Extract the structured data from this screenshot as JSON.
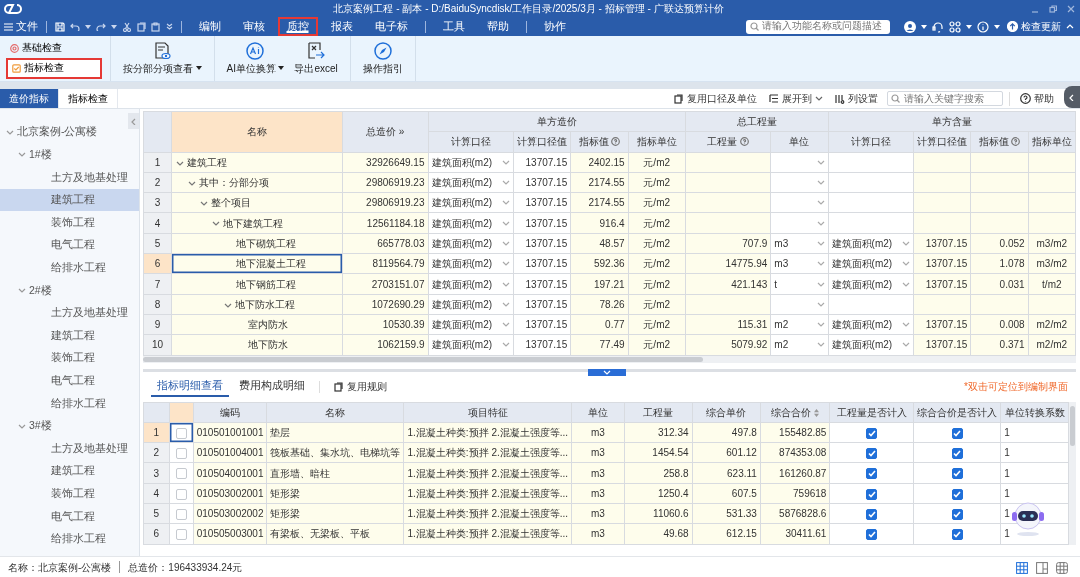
{
  "window": {
    "title": "北京案例工程 - 副本 - D:/BaiduSyncdisk/工作目录/2025/3月 - 招标管理 - 广联达预算计价"
  },
  "menu": {
    "file": "文件",
    "groups": [
      [
        {
          "label": "编制",
          "selected": false,
          "highlighted": false
        },
        {
          "label": "审核",
          "selected": false,
          "highlighted": false
        },
        {
          "label": "质控",
          "selected": true,
          "highlighted": true
        },
        {
          "label": "报表",
          "selected": false,
          "highlighted": false
        },
        {
          "label": "电子标",
          "selected": false,
          "highlighted": false
        }
      ],
      [
        {
          "label": "工具",
          "selected": false,
          "highlighted": false
        },
        {
          "label": "帮助",
          "selected": false,
          "highlighted": false
        }
      ],
      [
        {
          "label": "协作",
          "selected": false,
          "highlighted": false
        }
      ]
    ],
    "search": {
      "placeholder": "请输入功能名称或问题描述"
    },
    "update": "检查更新"
  },
  "ribbon": {
    "checks": [
      {
        "label": "基础检查",
        "kind": "basic",
        "selected": false,
        "highlighted": false
      },
      {
        "label": "指标检查",
        "kind": "index",
        "selected": true,
        "highlighted": true
      }
    ],
    "groups": [
      [
        {
          "label": "按分部分项查看",
          "kind": "view",
          "dropdown": true
        }
      ],
      [
        {
          "label": "AI单位换算",
          "kind": "ai",
          "dropdown": true
        },
        {
          "label": "导出excel",
          "kind": "export",
          "dropdown": false
        }
      ],
      [
        {
          "label": "操作指引",
          "kind": "guide",
          "dropdown": false
        }
      ]
    ]
  },
  "view_tabs": [
    {
      "label": "造价指标",
      "selected": true
    },
    {
      "label": "指标检查",
      "selected": false
    }
  ],
  "tools": {
    "reuse": "复用口径及单位",
    "expand": "展开到",
    "columns": "列设置",
    "search": {
      "placeholder": "请输入关键字搜索"
    },
    "help": "帮助"
  },
  "tree": [
    {
      "label": "北京案例-公寓楼",
      "expanded": true,
      "selected": false,
      "children": [
        {
          "label": "1#楼",
          "expanded": true,
          "selected": false,
          "children": [
            {
              "label": "土方及地基处理",
              "selected": false
            },
            {
              "label": "建筑工程",
              "selected": true
            },
            {
              "label": "装饰工程",
              "selected": false
            },
            {
              "label": "电气工程",
              "selected": false
            },
            {
              "label": "给排水工程",
              "selected": false
            }
          ]
        },
        {
          "label": "2#楼",
          "expanded": true,
          "selected": false,
          "children": [
            {
              "label": "土方及地基处理",
              "selected": false
            },
            {
              "label": "建筑工程",
              "selected": false
            },
            {
              "label": "装饰工程",
              "selected": false
            },
            {
              "label": "电气工程",
              "selected": false
            },
            {
              "label": "给排水工程",
              "selected": false
            }
          ]
        },
        {
          "label": "3#楼",
          "expanded": true,
          "selected": false,
          "children": [
            {
              "label": "土方及地基处理",
              "selected": false
            },
            {
              "label": "建筑工程",
              "selected": false
            },
            {
              "label": "装饰工程",
              "selected": false
            },
            {
              "label": "电气工程",
              "selected": false
            },
            {
              "label": "给排水工程",
              "selected": false
            }
          ]
        }
      ]
    }
  ],
  "index_table": {
    "header": {
      "name": "名称",
      "total": "总造价 »",
      "groups": [
        {
          "label": "单方造价",
          "columns": [
            {
              "label": "计算口径",
              "help": false
            },
            {
              "label": "计算口径值",
              "help": false
            },
            {
              "label": "指标值",
              "help": true
            },
            {
              "label": "指标单位",
              "help": false
            }
          ]
        },
        {
          "label": "总工程量",
          "columns": [
            {
              "label": "工程量",
              "help": true
            },
            {
              "label": "单位",
              "help": false
            }
          ]
        },
        {
          "label": "单方含量",
          "columns": [
            {
              "label": "计算口径",
              "help": false
            },
            {
              "label": "计算口径值",
              "help": false
            },
            {
              "label": "指标值",
              "help": true
            },
            {
              "label": "指标单位",
              "help": false
            }
          ]
        }
      ]
    },
    "rows": [
      {
        "no": "1",
        "name": "建筑工程",
        "expanded": true,
        "selected": false,
        "total": "32926649.15",
        "basis": "建筑面积(m2)",
        "basis_value": "13707.15",
        "index": "2402.15",
        "index_unit": "元/m2",
        "children": [
          {
            "no": "2",
            "name": "其中：分部分项",
            "expanded": true,
            "selected": false,
            "total": "29806919.23",
            "basis": "建筑面积(m2)",
            "basis_value": "13707.15",
            "index": "2174.55",
            "index_unit": "元/m2",
            "children": [
              {
                "no": "3",
                "name": "整个项目",
                "expanded": true,
                "selected": false,
                "total": "29806919.23",
                "basis": "建筑面积(m2)",
                "basis_value": "13707.15",
                "index": "2174.55",
                "index_unit": "元/m2",
                "children": [
                  {
                    "no": "4",
                    "name": "地下建筑工程",
                    "expanded": true,
                    "selected": false,
                    "total": "12561184.18",
                    "basis": "建筑面积(m2)",
                    "basis_value": "13707.15",
                    "index": "916.4",
                    "index_unit": "元/m2",
                    "children": [
                      {
                        "no": "5",
                        "name": "地下砌筑工程",
                        "selected": false,
                        "total": "665778.03",
                        "basis": "建筑面积(m2)",
                        "basis_value": "13707.15",
                        "index": "48.57",
                        "index_unit": "元/m2",
                        "qty": "707.9",
                        "unit": "m3",
                        "c_basis": "建筑面积(m2)",
                        "c_basis_value": "13707.15",
                        "c_index": "0.052",
                        "c_index_unit": "m3/m2"
                      },
                      {
                        "no": "6",
                        "name": "地下混凝土工程",
                        "selected": true,
                        "total": "8119564.79",
                        "basis": "建筑面积(m2)",
                        "basis_value": "13707.15",
                        "index": "592.36",
                        "index_unit": "元/m2",
                        "qty": "14775.94",
                        "unit": "m3",
                        "c_basis": "建筑面积(m2)",
                        "c_basis_value": "13707.15",
                        "c_index": "1.078",
                        "c_index_unit": "m3/m2"
                      },
                      {
                        "no": "7",
                        "name": "地下钢筋工程",
                        "selected": false,
                        "total": "2703151.07",
                        "basis": "建筑面积(m2)",
                        "basis_value": "13707.15",
                        "index": "197.21",
                        "index_unit": "元/m2",
                        "qty": "421.143",
                        "unit": "t",
                        "c_basis": "建筑面积(m2)",
                        "c_basis_value": "13707.15",
                        "c_index": "0.031",
                        "c_index_unit": "t/m2"
                      },
                      {
                        "no": "8",
                        "name": "地下防水工程",
                        "expanded": true,
                        "selected": false,
                        "total": "1072690.29",
                        "basis": "建筑面积(m2)",
                        "basis_value": "13707.15",
                        "index": "78.26",
                        "index_unit": "元/m2",
                        "children": [
                          {
                            "no": "9",
                            "name": "室内防水",
                            "selected": false,
                            "total": "10530.39",
                            "basis": "建筑面积(m2)",
                            "basis_value": "13707.15",
                            "index": "0.77",
                            "index_unit": "元/m2",
                            "qty": "115.31",
                            "unit": "m2",
                            "c_basis": "建筑面积(m2)",
                            "c_basis_value": "13707.15",
                            "c_index": "0.008",
                            "c_index_unit": "m2/m2"
                          },
                          {
                            "no": "10",
                            "name": "地下防水",
                            "selected": false,
                            "total": "1062159.9",
                            "basis": "建筑面积(m2)",
                            "basis_value": "13707.15",
                            "index": "77.49",
                            "index_unit": "元/m2",
                            "qty": "5079.92",
                            "unit": "m2",
                            "c_basis": "建筑面积(m2)",
                            "c_basis_value": "13707.15",
                            "c_index": "0.371",
                            "c_index_unit": "m2/m2"
                          }
                        ]
                      }
                    ]
                  }
                ]
              }
            ]
          }
        ]
      }
    ]
  },
  "detail": {
    "tabs": [
      {
        "label": "指标明细查看",
        "selected": true
      },
      {
        "label": "费用构成明细",
        "selected": false
      }
    ],
    "reuse_rule": "复用规则",
    "note": "*双击可定位到编制界面",
    "columns": [
      {
        "label": "编码",
        "sortable": false
      },
      {
        "label": "名称",
        "sortable": false
      },
      {
        "label": "项目特征",
        "sortable": false
      },
      {
        "label": "单位",
        "sortable": false
      },
      {
        "label": "工程量",
        "sortable": false
      },
      {
        "label": "综合单价",
        "sortable": false
      },
      {
        "label": "综合合价",
        "sortable": true
      },
      {
        "label": "工程量是否计入",
        "sortable": false
      },
      {
        "label": "综合合价是否计入",
        "sortable": false
      },
      {
        "label": "单位转换系数",
        "sortable": false
      }
    ],
    "rows": [
      {
        "no": "1",
        "selected": true,
        "checked": false,
        "code": "010501001001",
        "name": "垫层",
        "feature": "1.混凝土种类:预拌 2.混凝土强度等...",
        "unit": "m3",
        "qty": "312.34",
        "unit_price": "497.8",
        "total_price": "155482.85",
        "qty_included": true,
        "total_included": true,
        "factor": "1"
      },
      {
        "no": "2",
        "selected": false,
        "checked": false,
        "code": "010501004001",
        "name": "筏板基础、集水坑、电梯坑等",
        "feature": "1.混凝土种类:预拌 2.混凝土强度等...",
        "unit": "m3",
        "qty": "1454.54",
        "unit_price": "601.12",
        "total_price": "874353.08",
        "qty_included": true,
        "total_included": true,
        "factor": "1"
      },
      {
        "no": "3",
        "selected": false,
        "checked": false,
        "code": "010504001001",
        "name": "直形墙、暗柱",
        "feature": "1.混凝土种类:预拌 2.混凝土强度等...",
        "unit": "m3",
        "qty": "258.8",
        "unit_price": "623.11",
        "total_price": "161260.87",
        "qty_included": true,
        "total_included": true,
        "factor": "1"
      },
      {
        "no": "4",
        "selected": false,
        "checked": false,
        "code": "010503002001",
        "name": "矩形梁",
        "feature": "1.混凝土种类:预拌 2.混凝土强度等...",
        "unit": "m3",
        "qty": "1250.4",
        "unit_price": "607.5",
        "total_price": "759618",
        "qty_included": true,
        "total_included": true,
        "factor": "1"
      },
      {
        "no": "5",
        "selected": false,
        "checked": false,
        "code": "010503002002",
        "name": "矩形梁",
        "feature": "1.混凝土种类:预拌 2.混凝土强度等...",
        "unit": "m3",
        "qty": "11060.6",
        "unit_price": "531.33",
        "total_price": "5876828.6",
        "qty_included": true,
        "total_included": true,
        "factor": "1"
      },
      {
        "no": "6",
        "selected": false,
        "checked": false,
        "code": "010505003001",
        "name": "有梁板、无梁板、平板",
        "feature": "1.混凝土种类:预拌 2.混凝土强度等...",
        "unit": "m3",
        "qty": "49.68",
        "unit_price": "612.15",
        "total_price": "30411.61",
        "qty_included": true,
        "total_included": true,
        "factor": "1"
      }
    ]
  },
  "status": {
    "name": "名称：北京案例-公寓楼",
    "total": "总造价：196433934.24元",
    "views": [
      {
        "selected": true
      },
      {
        "selected": false
      },
      {
        "selected": false
      }
    ]
  }
}
